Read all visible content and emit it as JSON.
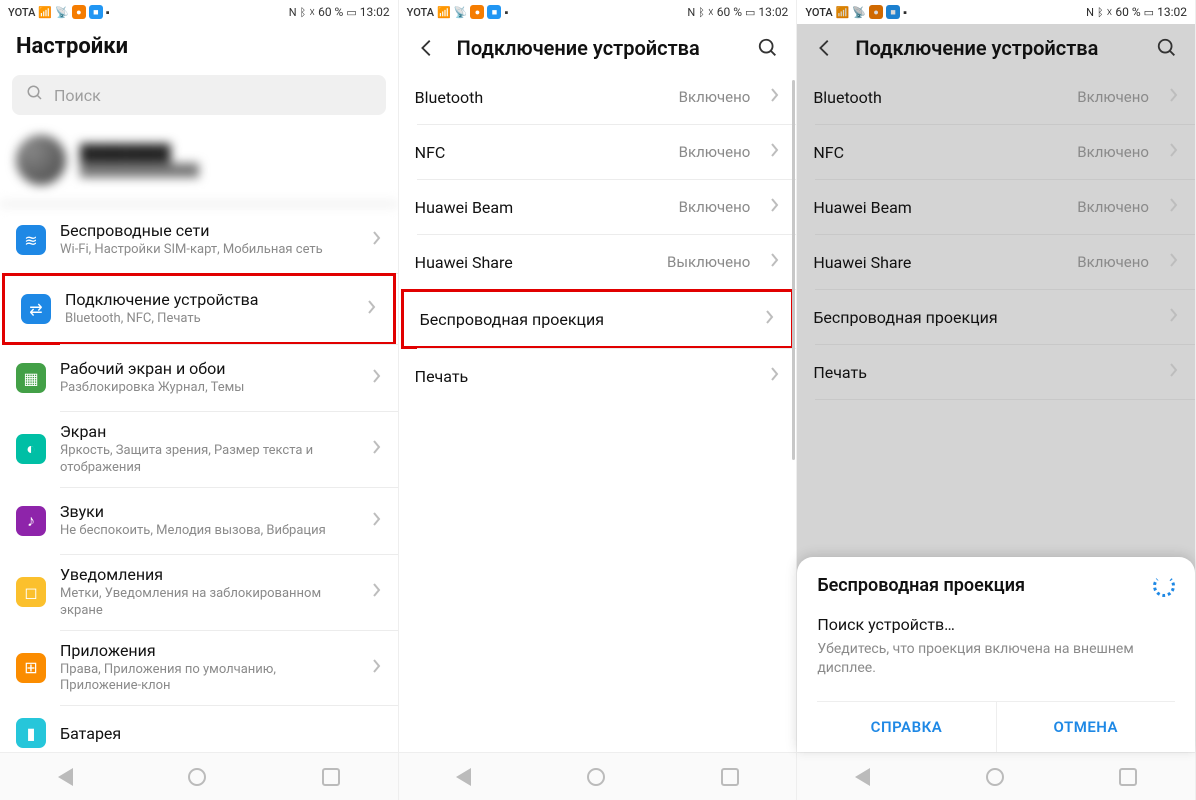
{
  "status_bar": {
    "carrier": "YOTA",
    "battery_pct": "60 %",
    "time": "13:02",
    "nfc": "N"
  },
  "screen1": {
    "title": "Настройки",
    "search_placeholder": "Поиск",
    "items": [
      {
        "title": "Беспроводные сети",
        "sub": "Wi-Fi, Настройки SIM-карт, Мобильная сеть",
        "icon_color": "#1e88e5",
        "glyph": "≋"
      },
      {
        "title": "Подключение устройства",
        "sub": "Bluetooth, NFC, Печать",
        "icon_color": "#1e88e5",
        "glyph": "⇄"
      },
      {
        "title": "Рабочий экран и обои",
        "sub": "Разблокировка Журнал, Темы",
        "icon_color": "#43a047",
        "glyph": "▦"
      },
      {
        "title": "Экран",
        "sub": "Яркость, Защита зрения, Размер текста и отображения",
        "icon_color": "#00bfa5",
        "glyph": "◐"
      },
      {
        "title": "Звуки",
        "sub": "Не беспокоить, Мелодия вызова, Вибрация",
        "icon_color": "#8e24aa",
        "glyph": "♪"
      },
      {
        "title": "Уведомления",
        "sub": "Метки, Уведомления на заблокированном экране",
        "icon_color": "#fbc02d",
        "glyph": "◻"
      },
      {
        "title": "Приложения",
        "sub": "Права, Приложения по умолчанию, Приложение-клон",
        "icon_color": "#fb8c00",
        "glyph": "⊞"
      },
      {
        "title": "Батарея",
        "sub": "",
        "icon_color": "#26c6da",
        "glyph": "▮"
      }
    ]
  },
  "screen2": {
    "title": "Подключение устройства",
    "items": [
      {
        "title": "Bluetooth",
        "value": "Включено"
      },
      {
        "title": "NFC",
        "value": "Включено"
      },
      {
        "title": "Huawei Beam",
        "value": "Включено"
      },
      {
        "title": "Huawei Share",
        "value": "Выключено"
      },
      {
        "title": "Беспроводная проекция",
        "value": ""
      },
      {
        "title": "Печать",
        "value": ""
      }
    ]
  },
  "screen3": {
    "title": "Подключение устройства",
    "items": [
      {
        "title": "Bluetooth",
        "value": "Включено"
      },
      {
        "title": "NFC",
        "value": "Включено"
      },
      {
        "title": "Huawei Beam",
        "value": "Включено"
      },
      {
        "title": "Huawei Share",
        "value": "Включено"
      },
      {
        "title": "Беспроводная проекция",
        "value": ""
      },
      {
        "title": "Печать",
        "value": ""
      }
    ],
    "sheet": {
      "title": "Беспроводная проекция",
      "searching": "Поиск устройств…",
      "hint": "Убедитесь, что проекция включена на внешнем дисплее.",
      "help": "СПРАВКА",
      "cancel": "ОТМЕНА"
    }
  }
}
